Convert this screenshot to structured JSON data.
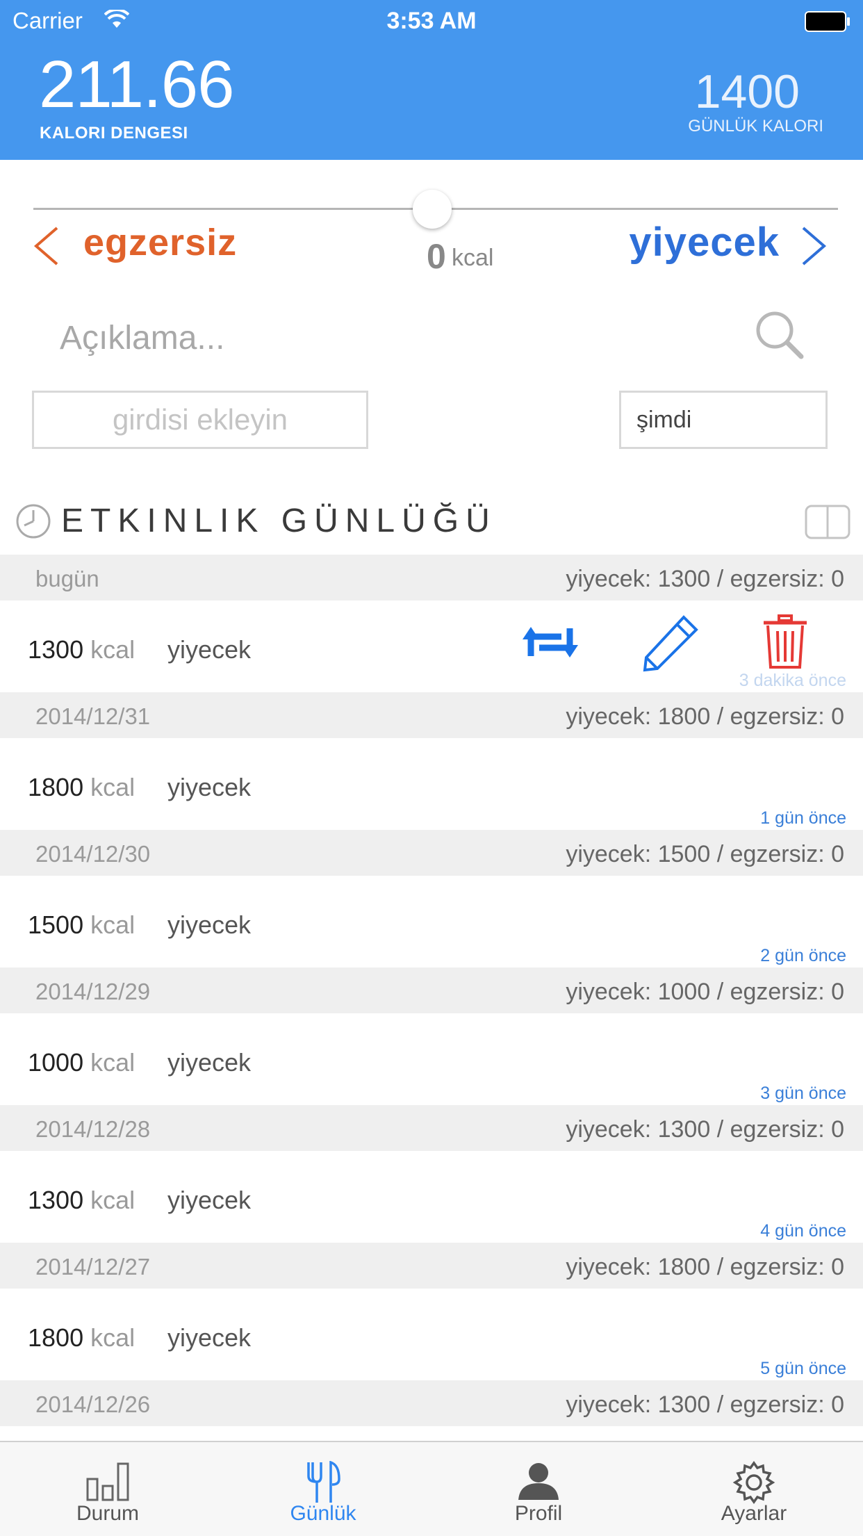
{
  "status_bar": {
    "carrier": "Carrier",
    "time": "3:53 AM"
  },
  "header": {
    "balance_value": "211.66",
    "balance_label": "KALORI DENGESI",
    "daily_value": "1400",
    "daily_label": "GÜNLÜK KALORI"
  },
  "entry_form": {
    "left_label": "egzersiz",
    "right_label": "yiyecek",
    "kcal_value": "0",
    "kcal_unit": "kcal",
    "slider_level": 0.5,
    "description_placeholder": "Açıklama...",
    "add_button_label": "girdisi ekleyin",
    "time_value": "şimdi"
  },
  "log": {
    "title": "ETKINLIK GÜNLÜĞÜ",
    "unit": "kcal",
    "days": [
      {
        "date": "bugün",
        "summary": "yiyecek: 1300 / egzersiz: 0",
        "entry": {
          "kcal": "1300",
          "type": "yiyecek",
          "ago": "3 dakika önce"
        }
      },
      {
        "date": "2014/12/31",
        "summary": "yiyecek: 1800 / egzersiz: 0",
        "entry": {
          "kcal": "1800",
          "type": "yiyecek",
          "ago": "1 gün önce"
        }
      },
      {
        "date": "2014/12/30",
        "summary": "yiyecek: 1500 / egzersiz: 0",
        "entry": {
          "kcal": "1500",
          "type": "yiyecek",
          "ago": "2 gün önce"
        }
      },
      {
        "date": "2014/12/29",
        "summary": "yiyecek: 1000 / egzersiz: 0",
        "entry": {
          "kcal": "1000",
          "type": "yiyecek",
          "ago": "3 gün önce"
        }
      },
      {
        "date": "2014/12/28",
        "summary": "yiyecek: 1300 / egzersiz: 0",
        "entry": {
          "kcal": "1300",
          "type": "yiyecek",
          "ago": "4 gün önce"
        }
      },
      {
        "date": "2014/12/27",
        "summary": "yiyecek: 1800 / egzersiz: 0",
        "entry": {
          "kcal": "1800",
          "type": "yiyecek",
          "ago": "5 gün önce"
        }
      },
      {
        "date": "2014/12/26",
        "summary": "yiyecek: 1300 / egzersiz: 0"
      }
    ]
  },
  "tabs": [
    {
      "label": "Durum",
      "icon": "bar-chart-icon"
    },
    {
      "label": "Günlük",
      "icon": "fork-knife-icon",
      "active": true
    },
    {
      "label": "Profil",
      "icon": "person-icon"
    },
    {
      "label": "Ayarlar",
      "icon": "gear-icon"
    }
  ],
  "colors": {
    "header_bg": "#4597ee",
    "exercise": "#e0622b",
    "food": "#2e6fd8",
    "delete": "#e53935",
    "active_tab": "#2f86f0"
  }
}
